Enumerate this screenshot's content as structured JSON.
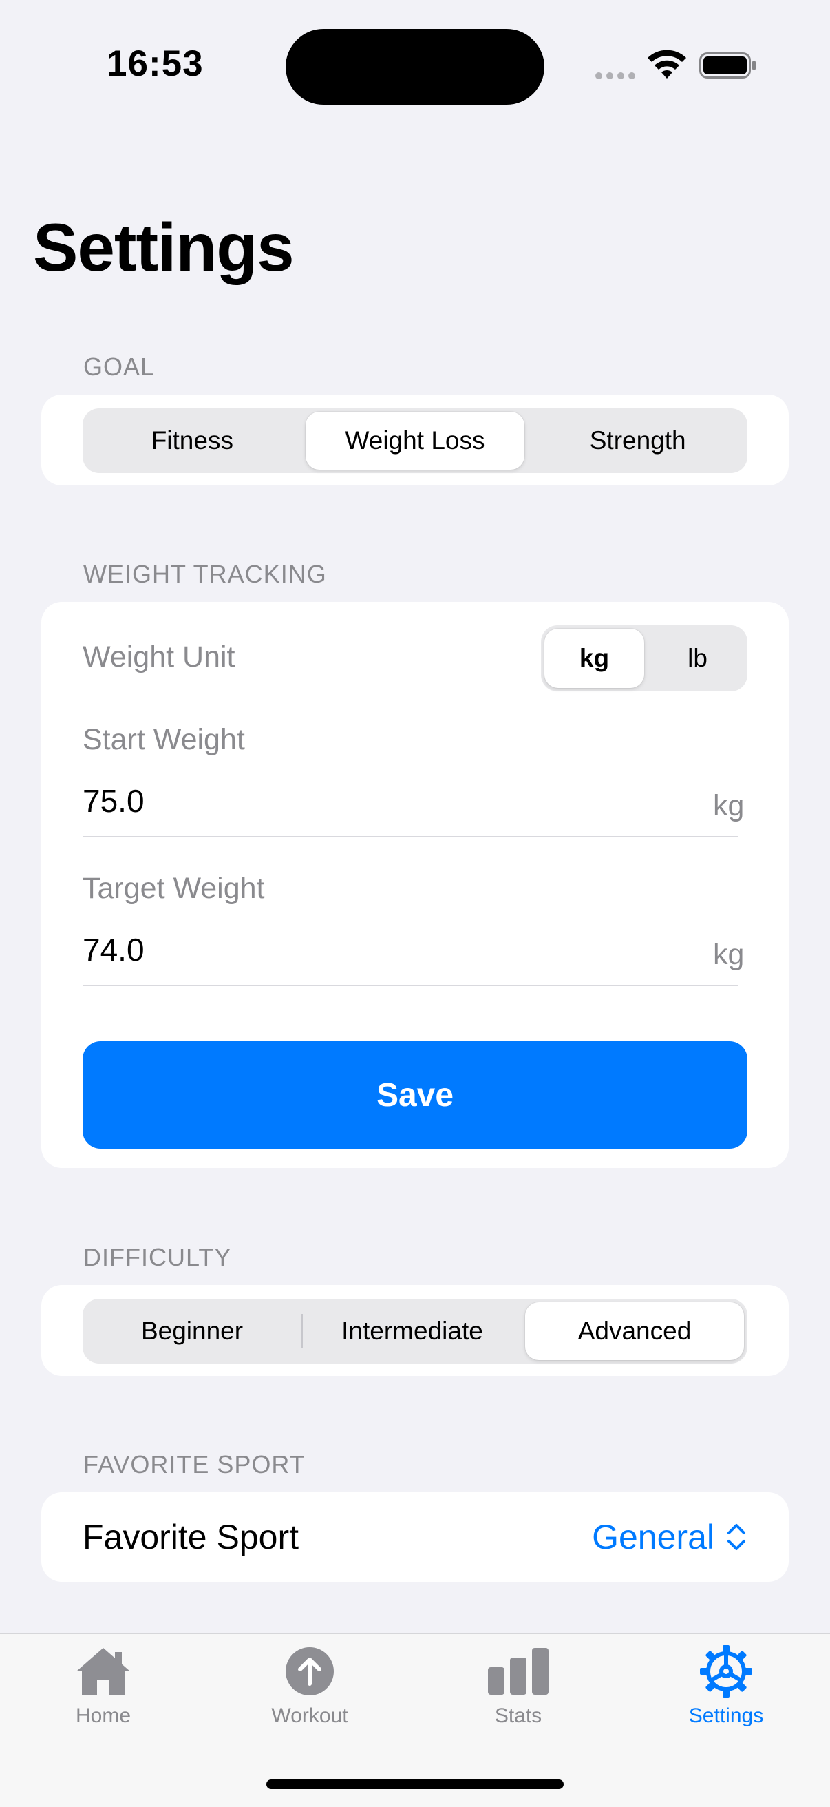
{
  "status_bar": {
    "time": "16:53"
  },
  "page": {
    "title": "Settings"
  },
  "goal": {
    "header": "GOAL",
    "options": [
      "Fitness",
      "Weight Loss",
      "Strength"
    ],
    "selected": "Weight Loss"
  },
  "weight_tracking": {
    "header": "WEIGHT TRACKING",
    "unit_label": "Weight Unit",
    "units": [
      "kg",
      "lb"
    ],
    "selected_unit": "kg",
    "start_label": "Start Weight",
    "start_value": "75.0",
    "start_unit": "kg",
    "target_label": "Target Weight",
    "target_value": "74.0",
    "target_unit": "kg",
    "save_label": "Save"
  },
  "difficulty": {
    "header": "DIFFICULTY",
    "options": [
      "Beginner",
      "Intermediate",
      "Advanced"
    ],
    "selected": "Advanced"
  },
  "favorite_sport": {
    "header": "FAVORITE SPORT",
    "label": "Favorite Sport",
    "value": "General"
  },
  "tab_bar": {
    "items": [
      {
        "label": "Home",
        "icon": "house-icon"
      },
      {
        "label": "Workout",
        "icon": "arrow-up-circle-icon"
      },
      {
        "label": "Stats",
        "icon": "bar-chart-icon"
      },
      {
        "label": "Settings",
        "icon": "gear-icon"
      }
    ],
    "active": "Settings"
  },
  "colors": {
    "accent": "#007aff",
    "background": "#f2f2f7",
    "secondary_text": "#8a8a8e",
    "inactive_icon": "#8e8e93"
  }
}
